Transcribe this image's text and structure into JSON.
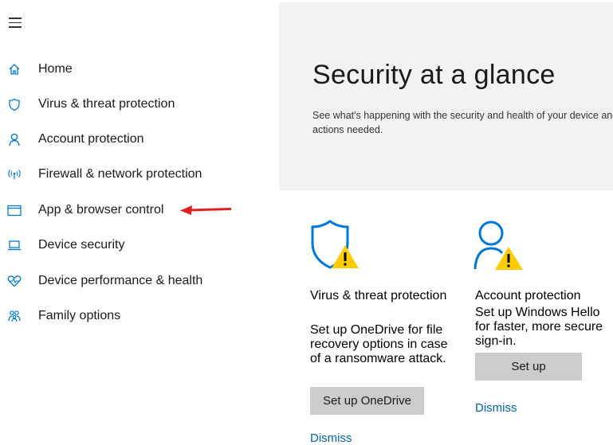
{
  "sidebar": {
    "menu_icon": "hamburger-icon",
    "items": [
      {
        "label": "Home",
        "icon": "home-icon"
      },
      {
        "label": "Virus & threat protection",
        "icon": "shield-icon"
      },
      {
        "label": "Account protection",
        "icon": "person-icon"
      },
      {
        "label": "Firewall & network protection",
        "icon": "wifi-icon"
      },
      {
        "label": "App & browser control",
        "icon": "window-icon"
      },
      {
        "label": "Device security",
        "icon": "laptop-icon"
      },
      {
        "label": "Device performance & health",
        "icon": "heart-icon"
      },
      {
        "label": "Family options",
        "icon": "family-icon"
      }
    ]
  },
  "hero": {
    "title": "Security at a glance",
    "description": "See what's happening with the security and health of your device and take any actions needed."
  },
  "cards": [
    {
      "title": "Virus & threat protection",
      "description": "Set up OneDrive for file recovery options in case of a ransomware attack.",
      "button": "Set up OneDrive",
      "link": "Dismiss",
      "icon": "shield-warning-icon"
    },
    {
      "title": "Account protection",
      "description": "Set up Windows Hello for faster, more secure sign-in.",
      "button": "Set up",
      "link": "Dismiss",
      "icon": "person-warning-icon"
    }
  ],
  "colors": {
    "accent": "#0078d7",
    "link": "#0063b1",
    "warning": "#ffcc00",
    "arrow": "#e02020",
    "hero_bg": "#f2f2f2",
    "button_bg": "#cccccc"
  }
}
